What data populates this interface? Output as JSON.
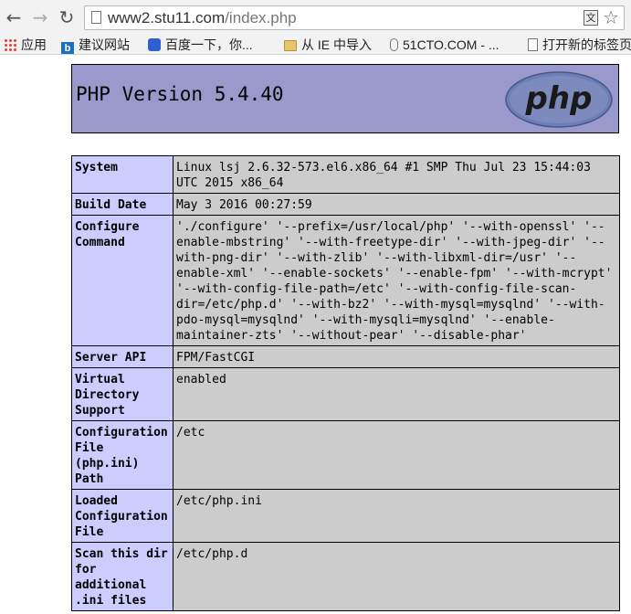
{
  "browser": {
    "back_icon": "back-arrow-icon",
    "forward_icon": "forward-arrow-icon",
    "reload_icon": "reload-icon",
    "url_host": "www2.stu11.com",
    "url_path": "/index.php",
    "translate_icon_label": "文",
    "star_icon": "star-icon"
  },
  "bookmarks": [
    {
      "label": "应用",
      "icon": "apps-grid-icon"
    },
    {
      "label": "建议网站",
      "icon": "bing-icon"
    },
    {
      "label": "百度一下，你...",
      "icon": "baidu-paw-icon"
    },
    {
      "label": "从 IE 中导入",
      "icon": "folder-icon"
    },
    {
      "label": "51CTO.COM - ...",
      "icon": "paperclip-icon"
    },
    {
      "label": "打开新的标签页",
      "icon": "page-icon"
    }
  ],
  "phpinfo": {
    "title": "PHP Version 5.4.40",
    "logo_text": "php",
    "colors": {
      "header_bg": "#9999cc",
      "key_bg": "#ccccff",
      "value_bg": "#cccccc"
    },
    "rows": [
      {
        "key": "System",
        "value": "Linux lsj 2.6.32-573.el6.x86_64 #1 SMP Thu Jul 23 15:44:03 UTC 2015 x86_64"
      },
      {
        "key": "Build Date",
        "value": "May 3 2016 00:27:59"
      },
      {
        "key": "Configure Command",
        "value": "'./configure' '--prefix=/usr/local/php' '--with-openssl' '--enable-mbstring' '--with-freetype-dir' '--with-jpeg-dir' '--with-png-dir' '--with-zlib' '--with-libxml-dir=/usr' '--enable-xml' '--enable-sockets' '--enable-fpm' '--with-mcrypt' '--with-config-file-path=/etc' '--with-config-file-scan-dir=/etc/php.d' '--with-bz2' '--with-mysql=mysqlnd' '--with-pdo-mysql=mysqlnd' '--with-mysqli=mysqlnd' '--enable-maintainer-zts' '--without-pear' '--disable-phar'"
      },
      {
        "key": "Server API",
        "value": "FPM/FastCGI"
      },
      {
        "key": "Virtual Directory Support",
        "value": "enabled"
      },
      {
        "key": "Configuration File (php.ini) Path",
        "value": "/etc"
      },
      {
        "key": "Loaded Configuration File",
        "value": "/etc/php.ini"
      },
      {
        "key": "Scan this dir for additional .ini files",
        "value": "/etc/php.d"
      }
    ]
  }
}
